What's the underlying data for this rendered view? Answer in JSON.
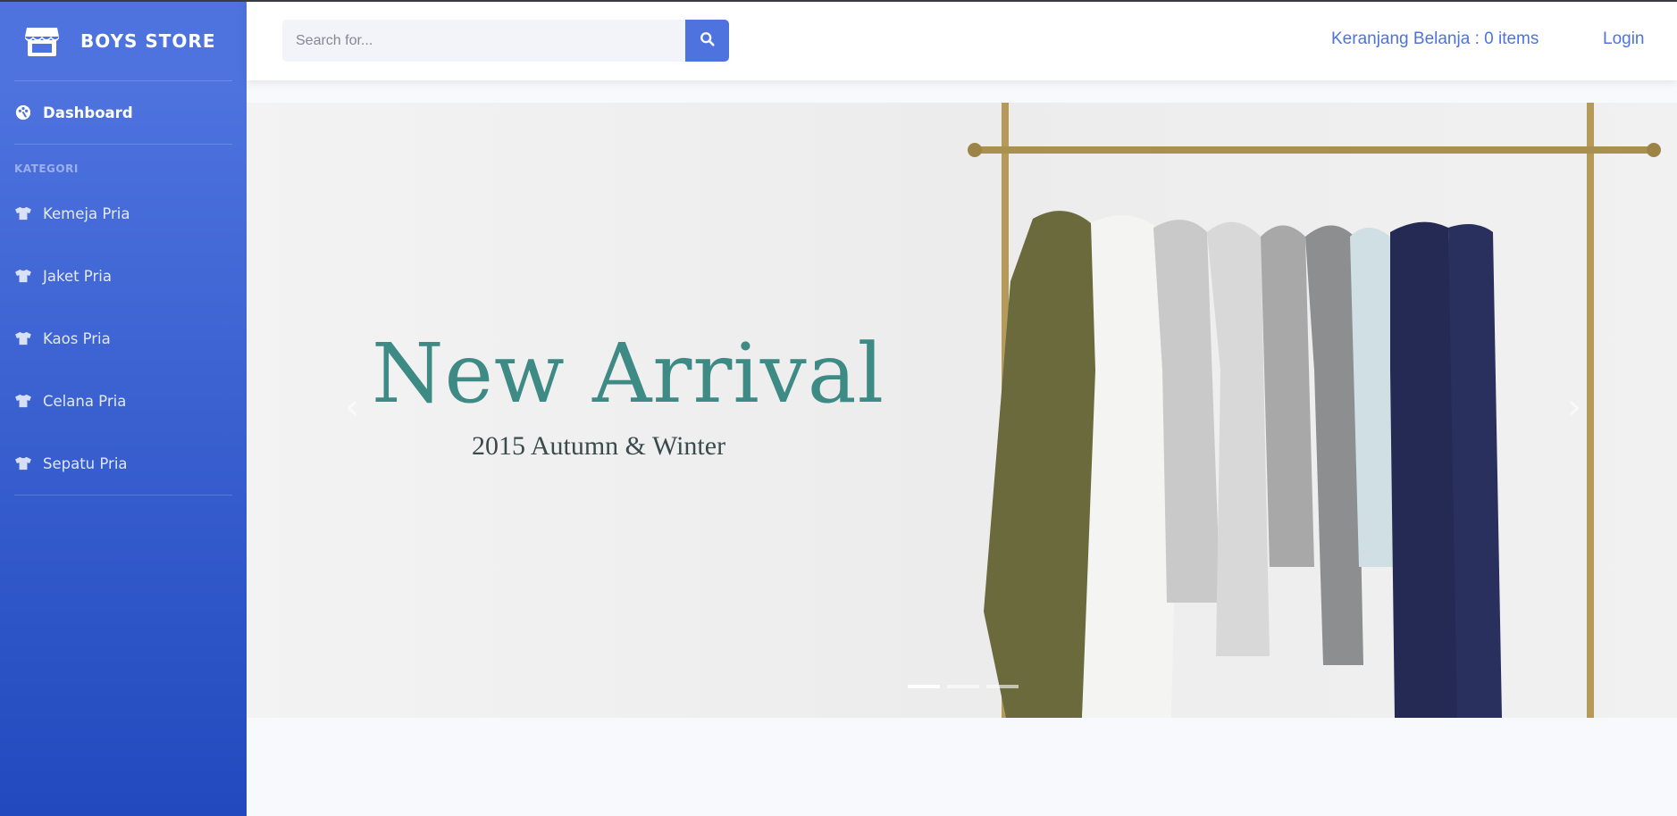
{
  "brand": {
    "name": "BOYS STORE",
    "icon": "store-icon"
  },
  "sidebar": {
    "dashboard": {
      "label": "Dashboard",
      "icon": "palette-icon"
    },
    "heading": "KATEGORI",
    "categories": [
      {
        "label": "Kemeja Pria",
        "icon": "tshirt-icon"
      },
      {
        "label": "Jaket Pria",
        "icon": "tshirt-icon"
      },
      {
        "label": "Kaos Pria",
        "icon": "tshirt-icon"
      },
      {
        "label": "Celana Pria",
        "icon": "tshirt-icon"
      },
      {
        "label": "Sepatu Pria",
        "icon": "tshirt-icon"
      }
    ]
  },
  "topbar": {
    "search_placeholder": "Search for...",
    "search_icon": "search-icon",
    "cart_label": "Keranjang Belanja : 0 items",
    "login_label": "Login"
  },
  "carousel": {
    "title": "New Arrival",
    "subtitle": "2015 Autumn & Winter",
    "prev_icon": "chevron-left-icon",
    "next_icon": "chevron-right-icon",
    "slide_count": 3,
    "active_slide": 1
  },
  "colors": {
    "primary": "#4e73df",
    "sidebar_dark": "#224abe",
    "title_teal": "#3e8a85"
  }
}
